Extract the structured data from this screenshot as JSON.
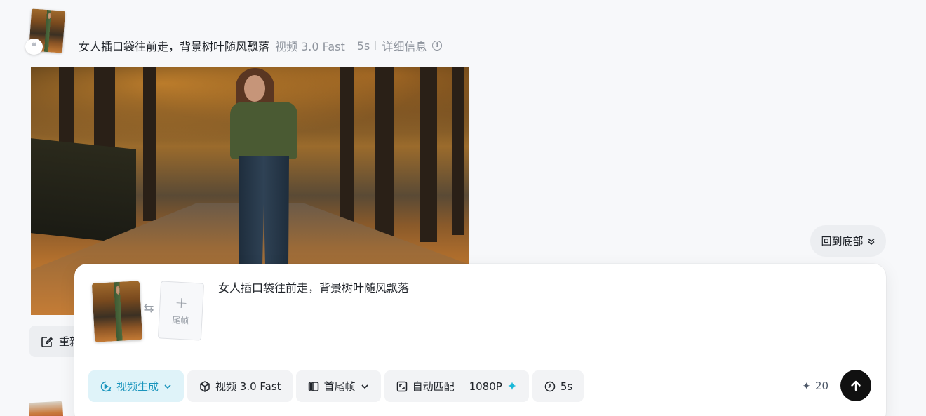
{
  "message": {
    "quote_icon": "quote-icon",
    "prompt": "女人插口袋往前走，背景树叶随风飘落",
    "model": "视频 3.0 Fast",
    "duration": "5s",
    "details_label": "详细信息",
    "regenerate_label": "重新"
  },
  "back_to_bottom_label": "回到底部",
  "composer": {
    "last_frame_label": "尾帧",
    "prompt_value": "女人插口袋往前走，背景树叶随风飘落",
    "toolbar": {
      "mode_label": "视频生成",
      "model_label": "视频 3.0 Fast",
      "frame_mode_label": "首尾帧",
      "ratio_label": "自动匹配",
      "resolution_label": "1080P",
      "duration_label": "5s"
    },
    "credits": "20"
  },
  "colors": {
    "accent": "#1a95bd",
    "accent_bg": "#dff3f9",
    "send_button": "#111111"
  }
}
